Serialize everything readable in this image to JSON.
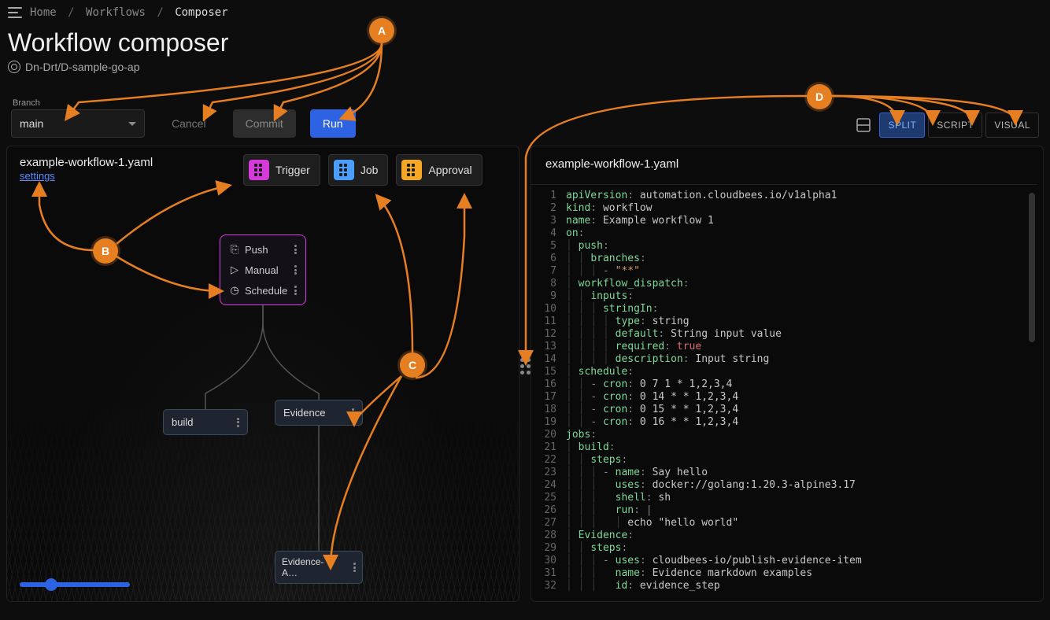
{
  "breadcrumb": {
    "home": "Home",
    "workflows": "Workflows",
    "current": "Composer"
  },
  "page_title": "Workflow composer",
  "repo": "Dn-Drt/D-sample-go-ap",
  "branch": {
    "label": "Branch",
    "value": "main"
  },
  "actions": {
    "cancel": "Cancel",
    "commit": "Commit",
    "run": "Run"
  },
  "view": {
    "split": "SPLIT",
    "script": "SCRIPT",
    "visual": "VISUAL",
    "active": "SPLIT"
  },
  "visual_pane": {
    "filename": "example-workflow-1.yaml",
    "settings": "settings",
    "palette": [
      {
        "label": "Trigger",
        "color": "pink"
      },
      {
        "label": "Job",
        "color": "blue"
      },
      {
        "label": "Approval",
        "color": "orange"
      }
    ],
    "triggers": [
      "Push",
      "Manual",
      "Schedule"
    ],
    "nodes": {
      "build": "build",
      "evidence": "Evidence",
      "evidence_a": "Evidence-A…"
    }
  },
  "script_pane": {
    "filename": "example-workflow-1.yaml",
    "line_count": 32
  },
  "annotations": {
    "A": "A",
    "B": "B",
    "C": "C",
    "D": "D"
  },
  "yaml": {
    "apiVersion": "automation.cloudbees.io/v1alpha1",
    "kind": "workflow",
    "name": "Example workflow 1",
    "on": {
      "push": {
        "branches": [
          "**"
        ]
      },
      "workflow_dispatch": {
        "inputs": {
          "stringIn": {
            "type": "string",
            "default": "String input value",
            "required": true,
            "description": "Input string"
          }
        }
      },
      "schedule": [
        "0 7 1 * 1,2,3,4",
        "0 14 * * 1,2,3,4",
        "0 15 * * 1,2,3,4",
        "0 16 * * 1,2,3,4"
      ]
    },
    "jobs": {
      "build": {
        "steps": [
          {
            "name": "Say hello",
            "uses": "docker://golang:1.20.3-alpine3.17",
            "shell": "sh",
            "run": "echo \"hello world\""
          }
        ]
      },
      "Evidence": {
        "steps": [
          {
            "uses": "cloudbees-io/publish-evidence-item",
            "name": "Evidence markdown examples",
            "id": "evidence_step"
          }
        ]
      }
    }
  }
}
